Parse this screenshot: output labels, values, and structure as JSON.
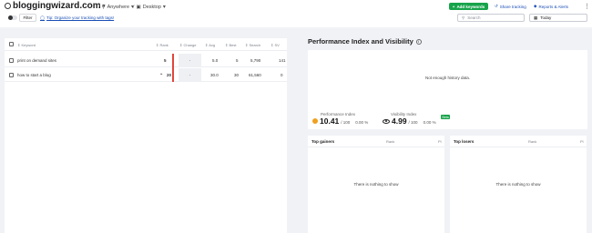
{
  "header": {
    "domain": "bloggingwizard.com",
    "location": "Anywhere",
    "device": "Desktop",
    "add_keywords": "Add keywords",
    "share_tracking": "Share tracking",
    "reports_alerts": "Reports & Alerts"
  },
  "toolbar": {
    "filter_label": "Filter",
    "tip_text": "Tip: Organize your tracking with tags!",
    "search_placeholder": "Search",
    "date_value": "Today"
  },
  "table": {
    "columns": {
      "keyword": "Keyword",
      "rank": "Rank",
      "change": "Change",
      "avg": "Avg",
      "best": "Best",
      "search": "Search",
      "sv": "SV"
    },
    "rows": [
      {
        "keyword": "print on demand sites",
        "rank": "5",
        "change": "-",
        "avg": "5.0",
        "best": "5",
        "search": "5,790",
        "sv": "141"
      },
      {
        "keyword": "how to start a blog",
        "rank": "20",
        "change": "-",
        "avg": "30.0",
        "best": "30",
        "search": "61,560",
        "sv": "0"
      }
    ]
  },
  "performance": {
    "title": "Performance Index and Visibility",
    "no_history": "Not enough history data.",
    "pi_label": "Performance Index",
    "pi_value": "10.41",
    "pi_max": "/ 100",
    "pi_change": "0.00 %",
    "vi_label": "Visibility Index",
    "vi_value": "4.99",
    "vi_max": "/ 100",
    "vi_change": "0.00 %",
    "beta": "Beta"
  },
  "gainers": {
    "title": "Top gainers",
    "rank_col": "Rank",
    "pl_col": "Pl",
    "empty": "There is nothing to show"
  },
  "losers": {
    "title": "Top losers",
    "rank_col": "Rank",
    "pl_col": "Pl",
    "empty": "There is nothing to show"
  },
  "colors": {
    "accent_green": "#17a34a",
    "link_blue": "#1a4fb5",
    "rank_bar_red": "#e1463c"
  }
}
